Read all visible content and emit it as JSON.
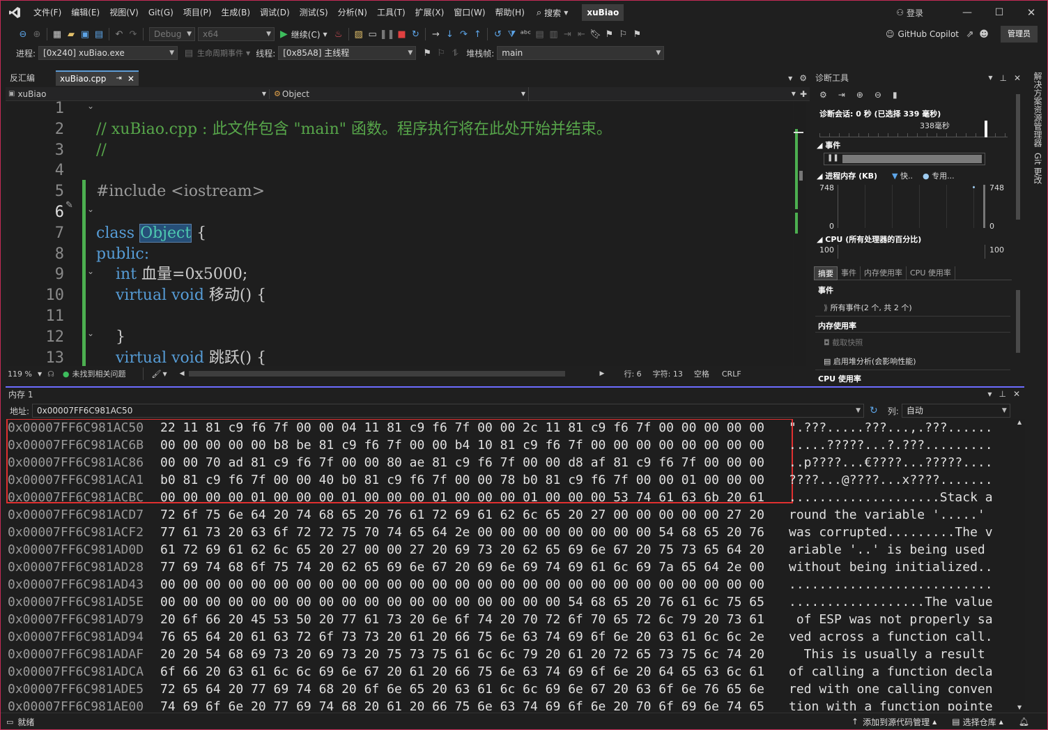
{
  "menu": [
    "文件(F)",
    "编辑(E)",
    "视图(V)",
    "Git(G)",
    "项目(P)",
    "生成(B)",
    "调试(D)",
    "测试(S)",
    "分析(N)",
    "工具(T)",
    "扩展(X)",
    "窗口(W)",
    "帮助(H)"
  ],
  "search_label": "搜索",
  "solution_name": "xuBiao",
  "login_label": "登录",
  "toolbar": {
    "config": "Debug",
    "platform": "x64",
    "continue_label": "继续(C)",
    "copilot_label": "GitHub Copilot",
    "admin_label": "管理员"
  },
  "debugbar": {
    "process_label": "进程:",
    "process_value": "[0x240] xuBiao.exe",
    "lifecycle_label": "生命周期事件",
    "thread_label": "线程:",
    "thread_value": "[0x85A8] 主线程",
    "stack_label": "堆栈帧:",
    "stack_value": "main"
  },
  "tabs": {
    "disasm": "反汇编",
    "file": "xuBiao.cpp",
    "pin": "⇥"
  },
  "nav": {
    "project": "xuBiao",
    "scope": "Object"
  },
  "code": {
    "line_numbers": [
      "1",
      "2",
      "3",
      "4",
      "5",
      "6",
      "7",
      "8",
      "9",
      "10",
      "11",
      "12",
      "13"
    ],
    "l1": "// xuBiao.cpp : 此文件包含 \"main\" 函数。程序执行将在此处开始并结束。",
    "l2": "//",
    "l4a": "#include",
    "l4b": " <iostream>",
    "l6a": "class",
    "l6b": "Object",
    "l6c": " {",
    "l7": "public:",
    "l8a": "int",
    "l8b": " 血量=0x5000;",
    "l9a": "virtual void",
    "l9b": " 移动() {",
    "l11": "}",
    "l12a": "virtual void",
    "l12b": " 跳跃() {"
  },
  "editor_status": {
    "zoom": "119 %",
    "issues": "未找到相关问题",
    "line": "行: 6",
    "char": "字符: 13",
    "spacing": "空格",
    "eol": "CRLF"
  },
  "diagnostics": {
    "title": "诊断工具",
    "session": "诊断会话: 0 秒 (已选择 339 毫秒)",
    "ruler": "338毫秒",
    "events": "事件",
    "memory": "进程内存 (KB)",
    "legend_snapshot": "快..",
    "legend_private": "专用...",
    "mem_max": "748",
    "mem_min": "0",
    "cpu": "CPU (所有处理器的百分比)",
    "cpu_max": "100",
    "subtabs": [
      "摘要",
      "事件",
      "内存使用率",
      "CPU 使用率"
    ],
    "sec_events": "事件",
    "all_events": "所有事件(2 个, 共 2 个)",
    "sec_memory": "内存使用率",
    "snapshot": "截取快照",
    "heap": "启用堆分析(会影响性能)",
    "sec_cpu": "CPU 使用率"
  },
  "rail": {
    "sol": "解决方案资源管理器",
    "git": "Git 更改"
  },
  "memory": {
    "title": "内存 1",
    "addr_label": "地址:",
    "addr_value": "0x00007FF6C981AC50",
    "col_label": "列:",
    "col_value": "自动",
    "rows": [
      {
        "addr": "0x00007FF6C981AC50",
        "hex": "22 11 81 c9 f6 7f 00 00 04 11 81 c9 f6 7f 00 00 2c 11 81 c9 f6 7f 00 00 00 00 00",
        "ascii": "\".???.....???...,.???......"
      },
      {
        "addr": "0x00007FF6C981AC6B",
        "hex": "00 00 00 00 00 b8 be 81 c9 f6 7f 00 00 b4 10 81 c9 f6 7f 00 00 00 00 00 00 00 00",
        "ascii": ".....?????...?.???........."
      },
      {
        "addr": "0x00007FF6C981AC86",
        "hex": "00 00 70 ad 81 c9 f6 7f 00 00 80 ae 81 c9 f6 7f 00 00 d8 af 81 c9 f6 7f 00 00 00",
        "ascii": "..p????...€????...?????...."
      },
      {
        "addr": "0x00007FF6C981ACA1",
        "hex": "b0 81 c9 f6 7f 00 00 40 b0 81 c9 f6 7f 00 00 78 b0 81 c9 f6 7f 00 00 01 00 00 00",
        "ascii": "????...@????...x????......."
      },
      {
        "addr": "0x00007FF6C981ACBC",
        "hex": "00 00 00 00 01 00 00 00 01 00 00 00 01 00 00 00 01 00 00 00 53 74 61 63 6b 20 61",
        "ascii": "....................Stack a"
      },
      {
        "addr": "0x00007FF6C981ACD7",
        "hex": "72 6f 75 6e 64 20 74 68 65 20 76 61 72 69 61 62 6c 65 20 27 00 00 00 00 00 27 20",
        "ascii": "round the variable '.....' "
      },
      {
        "addr": "0x00007FF6C981ACF2",
        "hex": "77 61 73 20 63 6f 72 72 75 70 74 65 64 2e 00 00 00 00 00 00 00 00 54 68 65 20 76",
        "ascii": "was corrupted.........The v"
      },
      {
        "addr": "0x00007FF6C981AD0D",
        "hex": "61 72 69 61 62 6c 65 20 27 00 00 27 20 69 73 20 62 65 69 6e 67 20 75 73 65 64 20",
        "ascii": "ariable '..' is being used "
      },
      {
        "addr": "0x00007FF6C981AD28",
        "hex": "77 69 74 68 6f 75 74 20 62 65 69 6e 67 20 69 6e 69 74 69 61 6c 69 7a 65 64 2e 00",
        "ascii": "without being initialized.."
      },
      {
        "addr": "0x00007FF6C981AD43",
        "hex": "00 00 00 00 00 00 00 00 00 00 00 00 00 00 00 00 00 00 00 00 00 00 00 00 00 00 00",
        "ascii": "..........................."
      },
      {
        "addr": "0x00007FF6C981AD5E",
        "hex": "00 00 00 00 00 00 00 00 00 00 00 00 00 00 00 00 00 00 54 68 65 20 76 61 6c 75 65",
        "ascii": "..................The value"
      },
      {
        "addr": "0x00007FF6C981AD79",
        "hex": "20 6f 66 20 45 53 50 20 77 61 73 20 6e 6f 74 20 70 72 6f 70 65 72 6c 79 20 73 61",
        "ascii": " of ESP was not properly sa"
      },
      {
        "addr": "0x00007FF6C981AD94",
        "hex": "76 65 64 20 61 63 72 6f 73 73 20 61 20 66 75 6e 63 74 69 6f 6e 20 63 61 6c 6c 2e",
        "ascii": "ved across a function call."
      },
      {
        "addr": "0x00007FF6C981ADAF",
        "hex": "20 20 54 68 69 73 20 69 73 20 75 73 75 61 6c 6c 79 20 61 20 72 65 73 75 6c 74 20",
        "ascii": "  This is usually a result "
      },
      {
        "addr": "0x00007FF6C981ADCA",
        "hex": "6f 66 20 63 61 6c 6c 69 6e 67 20 61 20 66 75 6e 63 74 69 6f 6e 20 64 65 63 6c 61",
        "ascii": "of calling a function decla"
      },
      {
        "addr": "0x00007FF6C981ADE5",
        "hex": "72 65 64 20 77 69 74 68 20 6f 6e 65 20 63 61 6c 6c 69 6e 67 20 63 6f 6e 76 65 6e",
        "ascii": "red with one calling conven"
      },
      {
        "addr": "0x00007FF6C981AE00",
        "hex": "74 69 6f 6e 20 77 69 74 68 20 61 20 66 75 6e 63 74 69 6f 6e 20 70 6f 69 6e 74 65",
        "ascii": "tion with a function pointe"
      }
    ]
  },
  "status": {
    "ready": "就绪",
    "add_src": "添加到源代码管理",
    "repo": "选择仓库"
  },
  "colors": {
    "accent": "#c42b56",
    "keyword": "#569cd6",
    "comment": "#57a64a",
    "type": "#4ec9b0"
  }
}
